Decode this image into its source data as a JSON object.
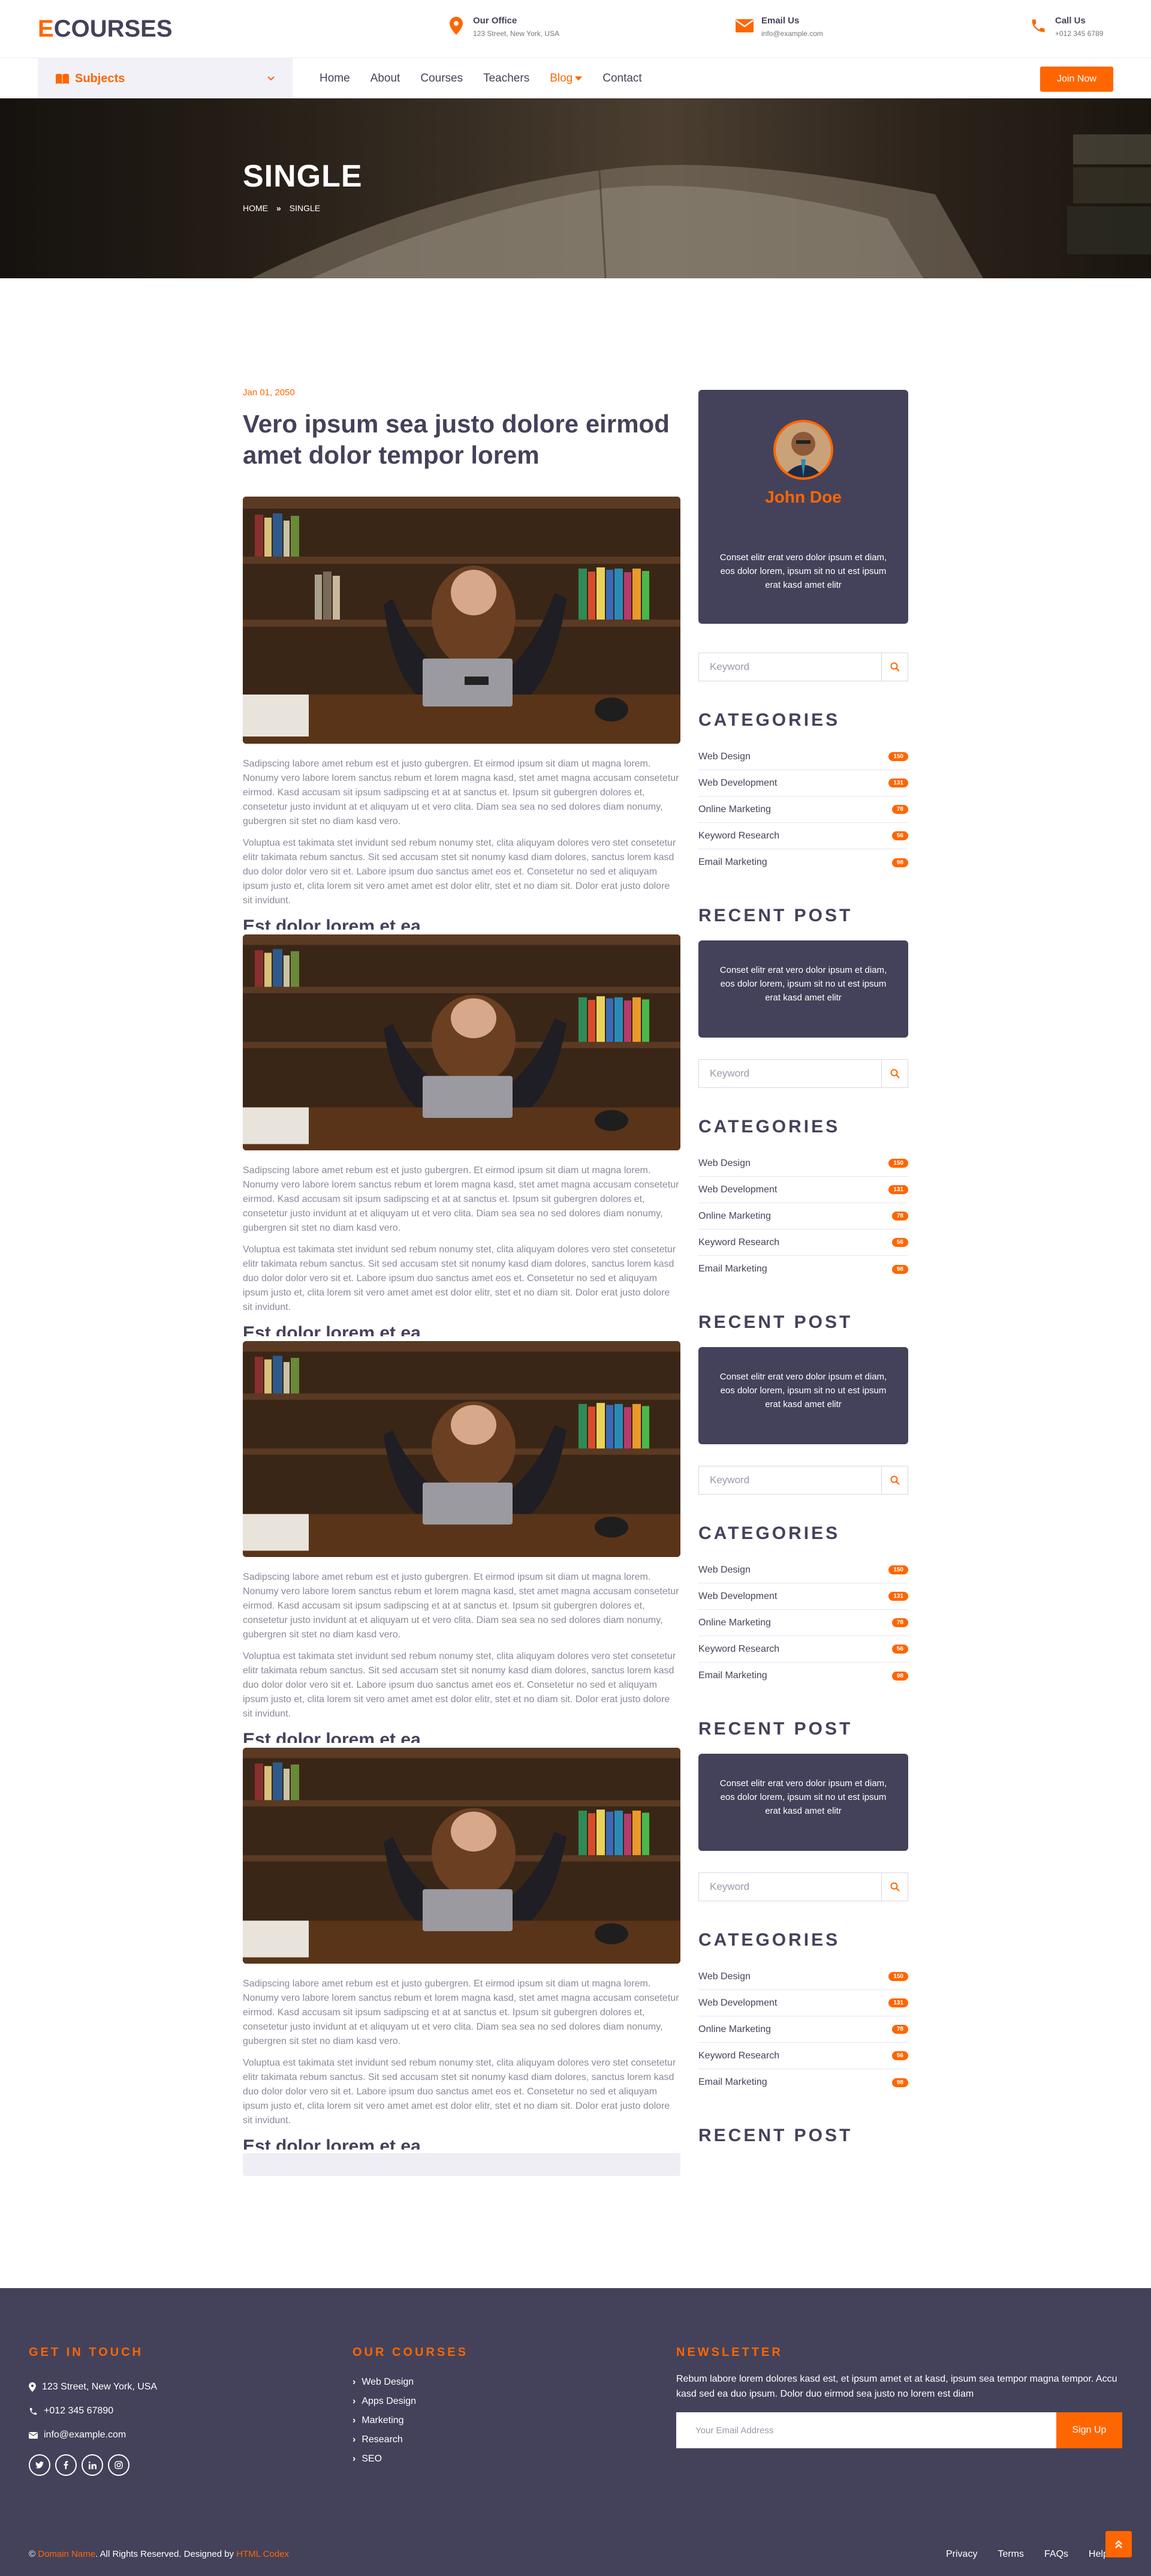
{
  "brand": {
    "letter": "E",
    "rest": "COURSES"
  },
  "contacts": [
    {
      "title": "Our Office",
      "value": "123 Street, New York, USA"
    },
    {
      "title": "Email Us",
      "value": "info@example.com"
    },
    {
      "title": "Call Us",
      "value": "+012 345 6789"
    }
  ],
  "nav": {
    "subjects": "Subjects",
    "items": [
      "Home",
      "About",
      "Courses",
      "Teachers",
      "Blog",
      "Contact"
    ],
    "active": "Blog",
    "join": "Join Now"
  },
  "hero": {
    "title": "SINGLE",
    "crumb_home": "HOME",
    "crumb_current": "SINGLE"
  },
  "post": {
    "date": "Jan 01, 2050",
    "title": "Vero ipsum sea justo dolore eirmod amet dolor tempor lorem",
    "para1": "Sadipscing labore amet rebum est et justo gubergren. Et eirmod ipsum sit diam ut magna lorem. Nonumy vero labore lorem sanctus rebum et lorem magna kasd, stet amet magna accusam consetetur eirmod. Kasd accusam sit ipsum sadipscing et at at sanctus et. Ipsum sit gubergren dolores et, consetetur justo invidunt at et aliquyam ut et vero clita. Diam sea sea no sed dolores diam nonumy, gubergren sit stet no diam kasd vero.",
    "para2": "Voluptua est takimata stet invidunt sed rebum nonumy stet, clita aliquyam dolores vero stet consetetur elitr takimata rebum sanctus. Sit sed accusam stet sit nonumy kasd diam dolores, sanctus lorem kasd duo dolor dolor vero sit et. Labore ipsum duo sanctus amet eos et. Consetetur no sed et aliquyam ipsum justo et, clita lorem sit vero amet amet est dolor elitr, stet et no diam sit. Dolor erat justo dolore sit invidunt.",
    "subhead": "Est dolor lorem et ea"
  },
  "sidebar": {
    "author_name": "John Doe",
    "author_text": "Conset elitr erat vero dolor ipsum et diam, eos dolor lorem, ipsum sit no ut est ipsum erat kasd amet elitr",
    "search_placeholder": "Keyword",
    "categories_title": "CATEGORIES",
    "recent_title": "RECENT POST",
    "categories": [
      {
        "name": "Web Design",
        "count": "150"
      },
      {
        "name": "Web Development",
        "count": "131"
      },
      {
        "name": "Online Marketing",
        "count": "78"
      },
      {
        "name": "Keyword Research",
        "count": "56"
      },
      {
        "name": "Email Marketing",
        "count": "98"
      }
    ]
  },
  "footer": {
    "touch_title": "GET IN TOUCH",
    "address": "123 Street, New York, USA",
    "phone": "+012 345 67890",
    "email": "info@example.com",
    "courses_title": "OUR COURSES",
    "courses": [
      "Web Design",
      "Apps Design",
      "Marketing",
      "Research",
      "SEO"
    ],
    "newsletter_title": "NEWSLETTER",
    "newsletter_text": "Rebum labore lorem dolores kasd est, et ipsum amet et at kasd, ipsum sea tempor magna tempor. Accu kasd sed ea duo ipsum. Dolor duo eirmod sea justo no lorem est diam",
    "email_placeholder": "Your Email Address",
    "signup": "Sign Up",
    "copy_domain": "Domain Name",
    "copy_mid": ". All Rights Reserved. Designed by",
    "copy_designer": "HTML Codex",
    "links": [
      "Privacy",
      "Terms",
      "FAQs",
      "Help"
    ]
  },
  "colors": {
    "accent": "#ff6600",
    "dark": "#44425a"
  }
}
